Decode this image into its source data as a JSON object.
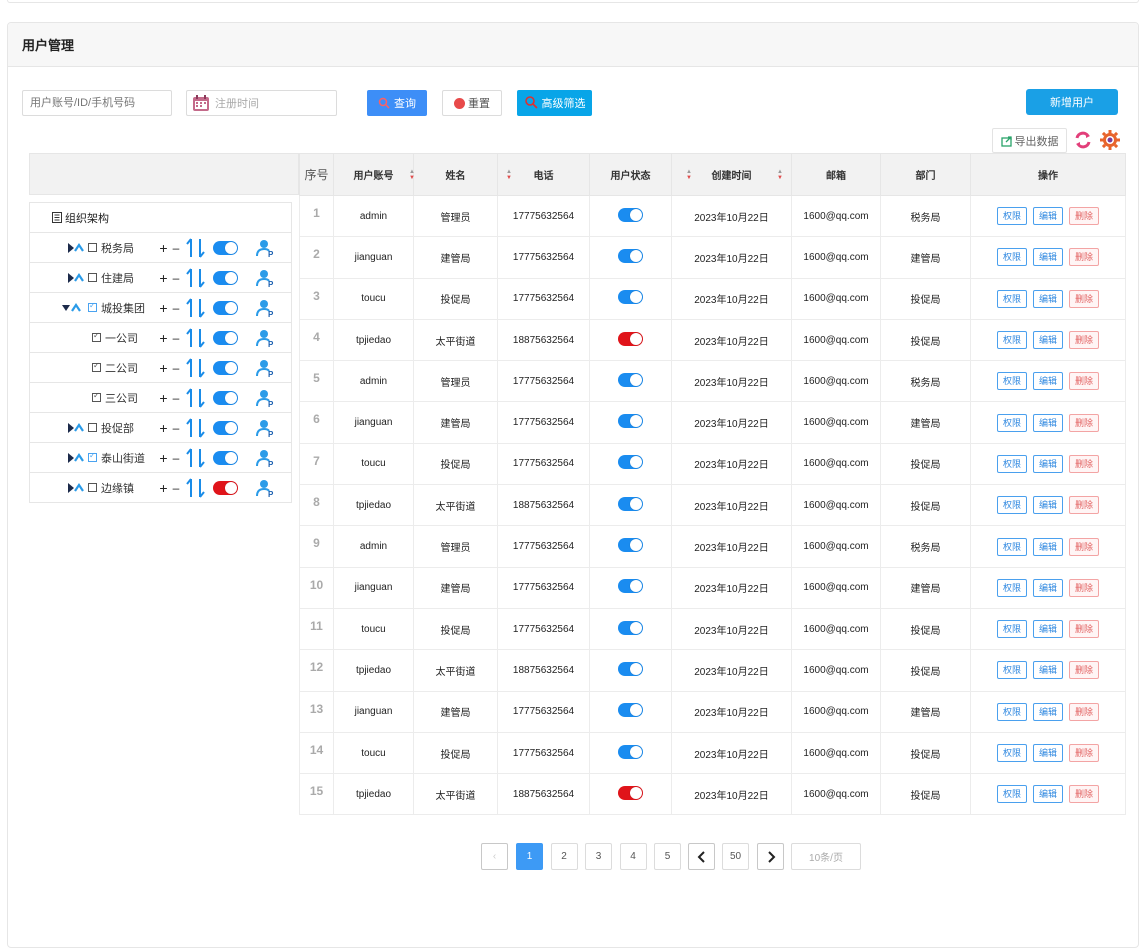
{
  "panel": {
    "title": "用户管理"
  },
  "search": {
    "account_placeholder": "用户账号/ID/手机号码",
    "date_placeholder": "注册时间"
  },
  "toolbar": {
    "query": "查询",
    "reset": "重置",
    "advanced": "高级筛选",
    "add_user": "新增用户",
    "export": "导出数据"
  },
  "tree": {
    "root": "组织架构",
    "items": [
      {
        "label": "税务局",
        "checked": false,
        "enabled": true
      },
      {
        "label": "住建局",
        "checked": false,
        "enabled": true
      },
      {
        "label": "城投集团",
        "checked": true,
        "enabled": true
      },
      {
        "label": "一公司",
        "checked": true,
        "enabled": true
      },
      {
        "label": "二公司",
        "checked": true,
        "enabled": true
      },
      {
        "label": "三公司",
        "checked": true,
        "enabled": true
      },
      {
        "label": "投促部",
        "checked": false,
        "enabled": true
      },
      {
        "label": "泰山街道",
        "checked": true,
        "enabled": true
      },
      {
        "label": "边缘镇",
        "checked": false,
        "enabled": false
      }
    ]
  },
  "table": {
    "headers": {
      "index": "序号",
      "account": "用户账号",
      "name": "姓名",
      "phone": "电话",
      "status": "用户状态",
      "created": "创建时间",
      "email": "邮箱",
      "dept": "部门",
      "ops": "操作"
    },
    "ops": {
      "perm": "权限",
      "edit": "编辑",
      "delete": "删除"
    },
    "rows": [
      {
        "idx": "1",
        "account": "admin",
        "name": "管理员",
        "phone": "17775632564",
        "status": true,
        "created": "2023年10月22日",
        "email": "1600@qq.com",
        "dept": "税务局"
      },
      {
        "idx": "2",
        "account": "jianguan",
        "name": "建管局",
        "phone": "17775632564",
        "status": true,
        "created": "2023年10月22日",
        "email": "1600@qq.com",
        "dept": "建管局"
      },
      {
        "idx": "3",
        "account": "toucu",
        "name": "投促局",
        "phone": "17775632564",
        "status": true,
        "created": "2023年10月22日",
        "email": "1600@qq.com",
        "dept": "投促局"
      },
      {
        "idx": "4",
        "account": "tpjiedao",
        "name": "太平街道",
        "phone": "18875632564",
        "status": false,
        "created": "2023年10月22日",
        "email": "1600@qq.com",
        "dept": "投促局"
      },
      {
        "idx": "5",
        "account": "admin",
        "name": "管理员",
        "phone": "17775632564",
        "status": true,
        "created": "2023年10月22日",
        "email": "1600@qq.com",
        "dept": "税务局"
      },
      {
        "idx": "6",
        "account": "jianguan",
        "name": "建管局",
        "phone": "17775632564",
        "status": true,
        "created": "2023年10月22日",
        "email": "1600@qq.com",
        "dept": "建管局"
      },
      {
        "idx": "7",
        "account": "toucu",
        "name": "投促局",
        "phone": "17775632564",
        "status": true,
        "created": "2023年10月22日",
        "email": "1600@qq.com",
        "dept": "投促局"
      },
      {
        "idx": "8",
        "account": "tpjiedao",
        "name": "太平街道",
        "phone": "18875632564",
        "status": true,
        "created": "2023年10月22日",
        "email": "1600@qq.com",
        "dept": "投促局"
      },
      {
        "idx": "9",
        "account": "admin",
        "name": "管理员",
        "phone": "17775632564",
        "status": true,
        "created": "2023年10月22日",
        "email": "1600@qq.com",
        "dept": "税务局"
      },
      {
        "idx": "10",
        "account": "jianguan",
        "name": "建管局",
        "phone": "17775632564",
        "status": true,
        "created": "2023年10月22日",
        "email": "1600@qq.com",
        "dept": "建管局"
      },
      {
        "idx": "11",
        "account": "toucu",
        "name": "投促局",
        "phone": "17775632564",
        "status": true,
        "created": "2023年10月22日",
        "email": "1600@qq.com",
        "dept": "投促局"
      },
      {
        "idx": "12",
        "account": "tpjiedao",
        "name": "太平街道",
        "phone": "18875632564",
        "status": true,
        "created": "2023年10月22日",
        "email": "1600@qq.com",
        "dept": "投促局"
      },
      {
        "idx": "13",
        "account": "jianguan",
        "name": "建管局",
        "phone": "17775632564",
        "status": true,
        "created": "2023年10月22日",
        "email": "1600@qq.com",
        "dept": "建管局"
      },
      {
        "idx": "14",
        "account": "toucu",
        "name": "投促局",
        "phone": "17775632564",
        "status": true,
        "created": "2023年10月22日",
        "email": "1600@qq.com",
        "dept": "投促局"
      },
      {
        "idx": "15",
        "account": "tpjiedao",
        "name": "太平街道",
        "phone": "18875632564",
        "status": false,
        "created": "2023年10月22日",
        "email": "1600@qq.com",
        "dept": "投促局"
      }
    ]
  },
  "pagination": {
    "pages": [
      "1",
      "2",
      "3",
      "4",
      "5"
    ],
    "current": "1",
    "last": "50",
    "page_size": "10条/页"
  },
  "colors": {
    "primary": "#3d8ef7",
    "accent": "#08a5e8",
    "toggle_on": "#1a8cf0",
    "toggle_off": "#e0141a",
    "delete": "#e26161"
  }
}
